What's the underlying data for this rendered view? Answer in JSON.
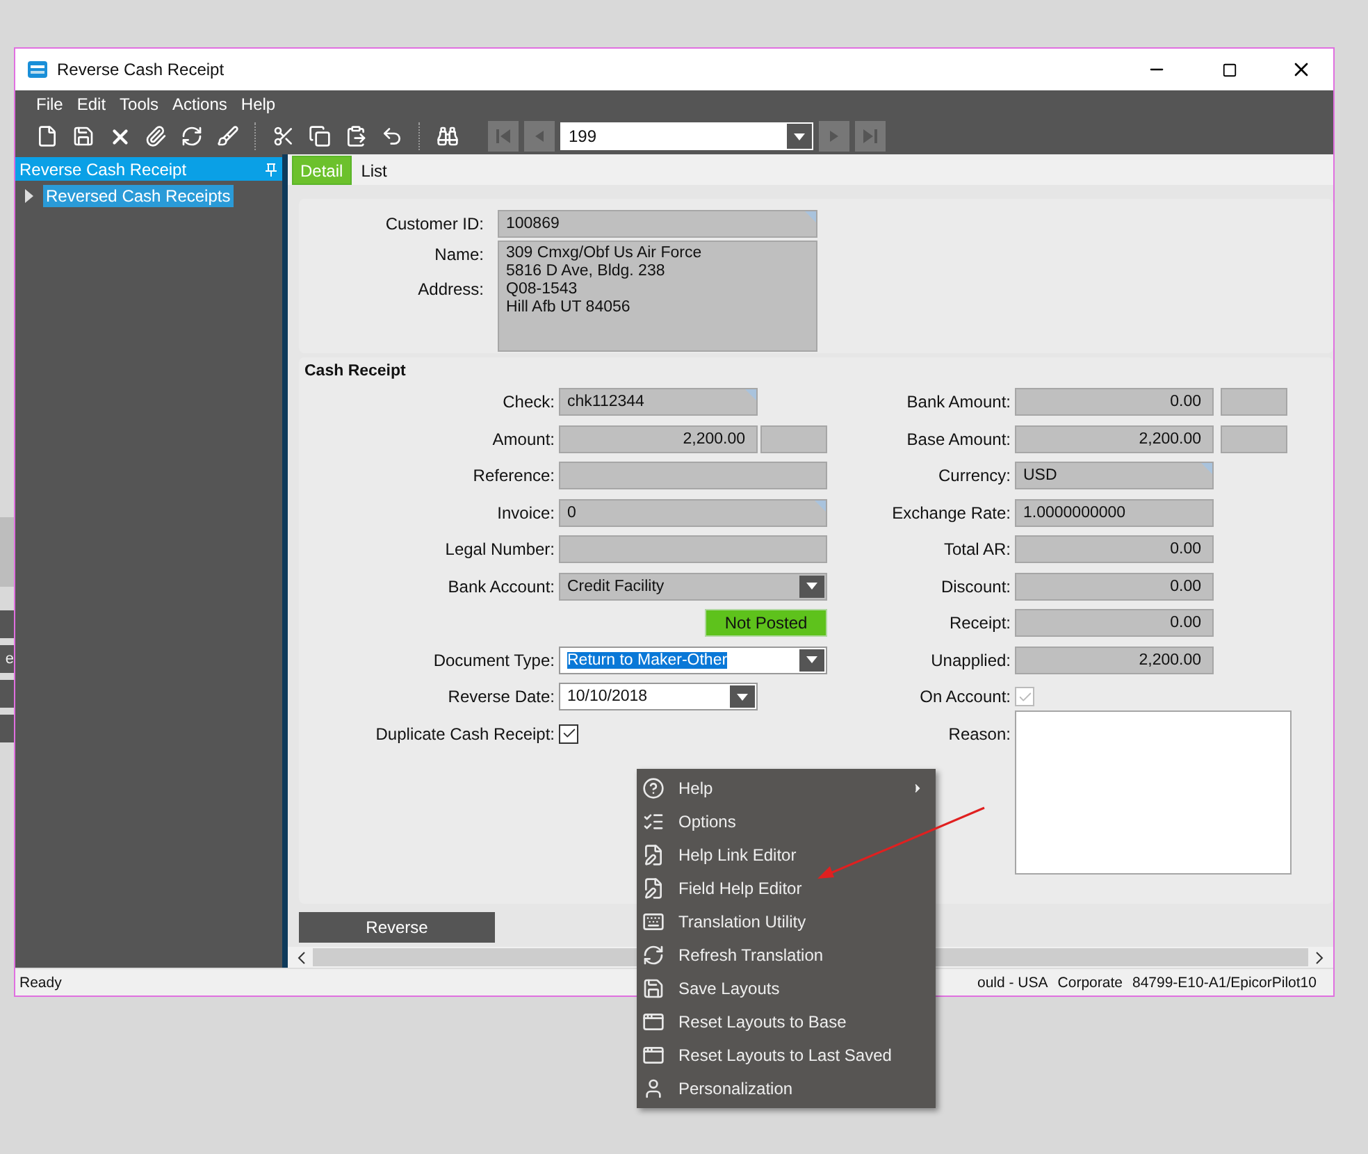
{
  "window": {
    "title": "Reverse Cash Receipt"
  },
  "background_app": {
    "fragments": [
      "e"
    ]
  },
  "menu_bar": [
    "File",
    "Edit",
    "Tools",
    "Actions",
    "Help"
  ],
  "toolbar": {
    "record": "199"
  },
  "sidebar": {
    "title": "Reverse Cash Receipt",
    "items": [
      {
        "label": "Reversed Cash Receipts",
        "selected": true,
        "expanded": false
      }
    ]
  },
  "tabs": [
    {
      "label": "Detail",
      "selected": true
    },
    {
      "label": "List",
      "selected": false
    }
  ],
  "customer": {
    "id_label": "Customer ID:",
    "id_value": "100869",
    "name_label": "Name:",
    "address_label": "Address:",
    "address_lines": [
      "309 Cmxg/Obf Us Air Force",
      "5816 D Ave, Bldg. 238",
      "Q08-1543",
      "Hill Afb UT 84056"
    ]
  },
  "cash_receipt": {
    "title": "Cash Receipt",
    "left": [
      {
        "kind": "text",
        "label": "Check:",
        "value": "chk112344",
        "corner_mark": true
      },
      {
        "kind": "amount",
        "label": "Amount:",
        "value": "2,200.00",
        "extra_box": true
      },
      {
        "kind": "text",
        "label": "Reference:"
      },
      {
        "kind": "text",
        "label": "Invoice:",
        "value": "0",
        "corner_mark": true
      },
      {
        "kind": "text",
        "label": "Legal Number:"
      },
      {
        "kind": "dropdown",
        "label": "Bank Account:",
        "value": "Credit Facility"
      },
      {
        "kind": "status",
        "value": "Not Posted"
      },
      {
        "kind": "dropdown",
        "label": "Document Type:",
        "value": "Return to Maker-Other",
        "editable": true,
        "highlighted": true
      },
      {
        "kind": "date",
        "label": "Reverse Date:",
        "value": "10/10/2018",
        "editable": true
      },
      {
        "kind": "checkbox",
        "label": "Duplicate Cash Receipt:",
        "checked": true,
        "disabled": false
      }
    ],
    "right": [
      {
        "kind": "amount",
        "label": "Bank Amount:",
        "value": "0.00",
        "extra_box": true
      },
      {
        "kind": "amount",
        "label": "Base Amount:",
        "value": "2,200.00",
        "extra_box": true
      },
      {
        "kind": "text",
        "label": "Currency:",
        "value": "USD",
        "corner_mark": true
      },
      {
        "kind": "text",
        "label": "Exchange Rate:",
        "value": "1.0000000000"
      },
      {
        "kind": "amount",
        "label": "Total AR:",
        "value": "0.00"
      },
      {
        "kind": "amount",
        "label": "Discount:",
        "value": "0.00"
      },
      {
        "kind": "amount",
        "label": "Receipt:",
        "value": "0.00"
      },
      {
        "kind": "amount",
        "label": "Unapplied:",
        "value": "2,200.00"
      },
      {
        "kind": "checkbox",
        "label": "On Account:",
        "checked": true,
        "disabled": true
      },
      {
        "kind": "memo",
        "label": "Reason:",
        "editable": true
      }
    ]
  },
  "actions": [
    {
      "label": "Reverse"
    }
  ],
  "status_bar": {
    "left": "Ready",
    "right": [
      "ould - USA",
      "Corporate",
      "84799-E10-A1/EpicorPilot10"
    ]
  },
  "context_menu": {
    "items": [
      {
        "kind": "help",
        "label": "Help",
        "submenu": true
      },
      {
        "kind": "options",
        "label": "Options",
        "submenu": false
      },
      {
        "kind": "editor",
        "label": "Help Link Editor",
        "submenu": false
      },
      {
        "kind": "editor",
        "label": "Field Help Editor",
        "submenu": false
      },
      {
        "kind": "keyboard",
        "label": "Translation Utility",
        "submenu": false
      },
      {
        "kind": "refresh",
        "label": "Refresh Translation",
        "submenu": false
      },
      {
        "kind": "save",
        "label": "Save Layouts",
        "submenu": false
      },
      {
        "kind": "layout",
        "label": "Reset Layouts to Base",
        "submenu": false
      },
      {
        "kind": "layout",
        "label": "Reset Layouts to Last Saved",
        "submenu": false
      },
      {
        "kind": "person",
        "label": "Personalization",
        "submenu": false
      }
    ]
  }
}
